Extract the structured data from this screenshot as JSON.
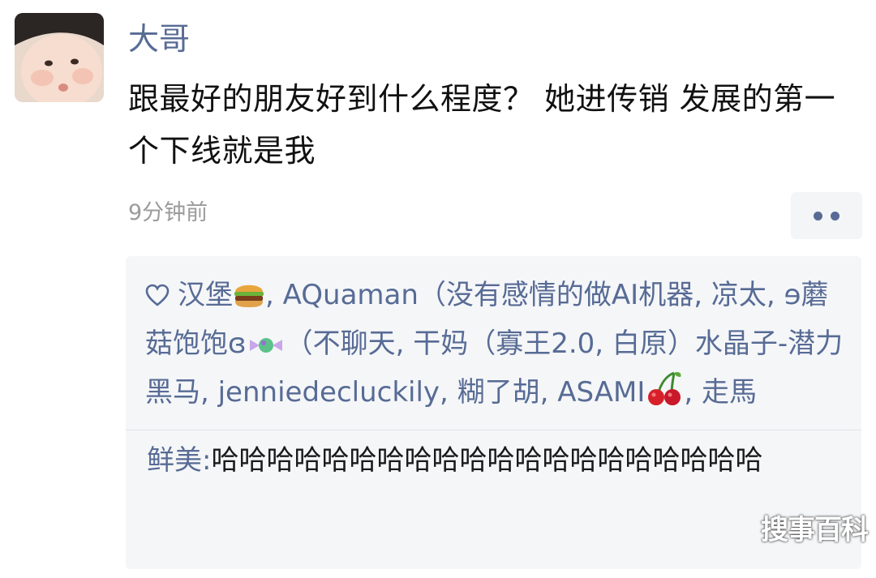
{
  "post": {
    "author": "大哥",
    "text": "跟最好的朋友好到什么程度？ 她进传销 发展的第一个下线就是我",
    "timestamp": "9分钟前"
  },
  "likes": {
    "segments": [
      "汉堡",
      ", AQuaman（没有感情的做AI机器, 凉太, ɘ蘑菇饱饱ɞ",
      "（不聊天, 干妈（寡王2.0, 白原）水晶子-潜力黑马, jenniedecluckily, 糊了胡, ASAMI",
      ", 走馬"
    ]
  },
  "comment": {
    "author": "鲜美",
    "separator": ":",
    "text": "哈哈哈哈哈哈哈哈哈哈哈哈哈哈哈哈哈哈哈哈"
  },
  "icons": {
    "heart": "heart-icon",
    "more": "more-dots-icon",
    "hamburger": "hamburger-emoji-icon",
    "candy": "candy-emoji-icon",
    "cherries": "cherries-emoji-icon"
  },
  "colors": {
    "link": "#576b95",
    "text": "#111111",
    "meta": "#9b9b9b",
    "panel": "#f5f6f8"
  },
  "watermark": "搜事百科"
}
